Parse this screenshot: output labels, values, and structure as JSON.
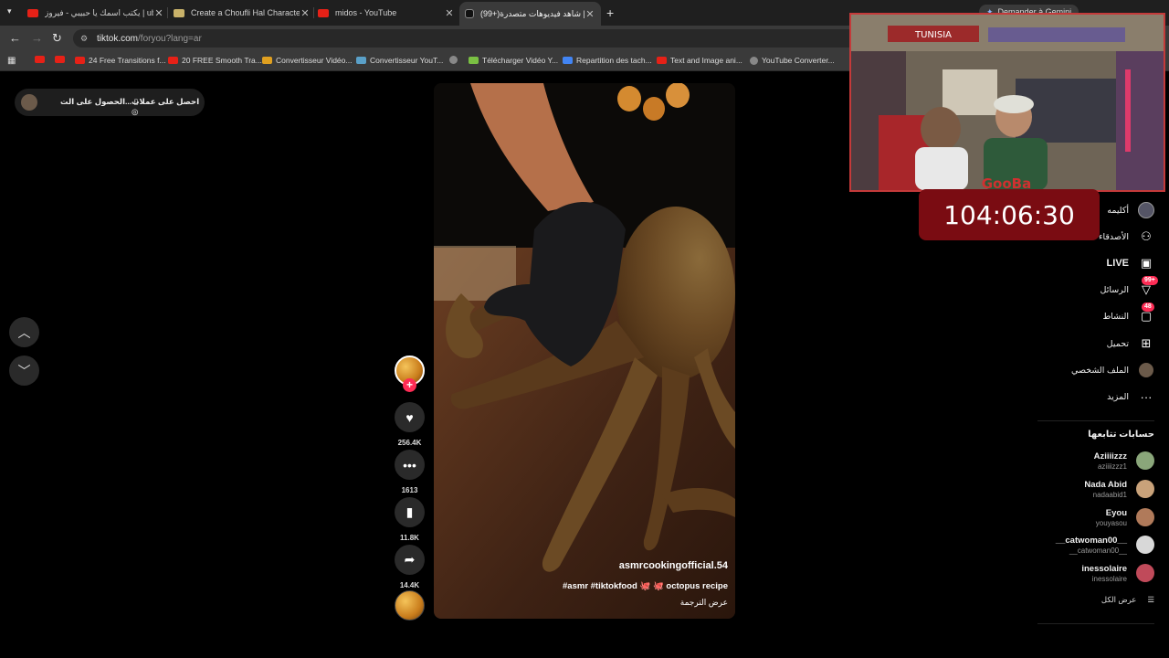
{
  "browser": {
    "tabs": [
      {
        "title": "يكتب اسمك يا حبيبي - فيروز | ube",
        "favicon_color": "#e62117"
      },
      {
        "title": "Create a Choufli Hal Character",
        "favicon_color": "#c9b26a"
      },
      {
        "title": "midos - YouTube",
        "favicon_color": "#e62117"
      },
      {
        "title": "(99+)شاهد فيديوهات متصدرة | ...",
        "favicon_color": "#111111"
      }
    ],
    "active_tab_index": 3,
    "url_host": "tiktok.com",
    "url_path": "/foryou?lang=ar",
    "gemini_label": "Demander à Gemini",
    "bookmarks": [
      {
        "label": "",
        "color": "#e62117"
      },
      {
        "label": "",
        "color": "#e62117"
      },
      {
        "label": "24 Free Transitions f...",
        "color": "#e62117"
      },
      {
        "label": "20 FREE Smooth Tra...",
        "color": "#e62117"
      },
      {
        "label": "Convertisseur Vidéo...",
        "color": "#e0a020"
      },
      {
        "label": "Convertisseur YouT...",
        "color": "#5aa0c8"
      },
      {
        "label": "",
        "color": "#888888"
      },
      {
        "label": "Télécharger Vidéo Y...",
        "color": "#7ac043"
      },
      {
        "label": "Repartition des tach...",
        "color": "#4285f4"
      },
      {
        "label": "Text and Image ani...",
        "color": "#e62117"
      },
      {
        "label": "YouTube Converter...",
        "color": "#888888"
      }
    ]
  },
  "tiktok": {
    "get_app": {
      "coins_label": "احصل على عملات",
      "app_label": "الحصول على الت..."
    },
    "video": {
      "username": "asmrcookingofficial.54",
      "description": "#asmr #tiktokfood 🐙 🐙 octopus recipe",
      "translate_label": "عرض الترجمة"
    },
    "actions": {
      "likes": "256.4K",
      "comments": "1613",
      "saves": "11.8K",
      "shares": "14.4K"
    },
    "sidebar": {
      "items": [
        {
          "label": "أكليمه",
          "icon": "profile-avatar-icon"
        },
        {
          "label": "الأصدقاء",
          "icon": "friends-icon"
        },
        {
          "label": "LIVE",
          "icon": "live-icon"
        },
        {
          "label": "الرسائل",
          "icon": "messages-icon",
          "badge": "99+"
        },
        {
          "label": "النشاط",
          "icon": "activity-icon",
          "badge": "48"
        },
        {
          "label": "تحميل",
          "icon": "upload-icon"
        },
        {
          "label": "الملف الشخصي",
          "icon": "profile-icon"
        },
        {
          "label": "المزيد",
          "icon": "more-icon"
        }
      ],
      "following_title": "حسابات تتابعها",
      "following": [
        {
          "name": "Aziiiizzz",
          "user": "aziiiizzz1",
          "color": "#8aa67a"
        },
        {
          "name": "Nada Abid",
          "user": "nadaabid1",
          "color": "#c9a27a"
        },
        {
          "name": "Eyou",
          "user": "youyasou",
          "color": "#b07a5a"
        },
        {
          "name": "__catwoman00__",
          "user": "__catwoman00__",
          "color": "#d8d8d8"
        },
        {
          "name": "inessolaire",
          "user": "inessolaire",
          "color": "#c04a5a"
        }
      ],
      "see_all": "عرض الكل"
    }
  },
  "overlay": {
    "timer": "104:06:30",
    "room_banner": "TUNISIA",
    "jersey_text": "GooBa"
  }
}
